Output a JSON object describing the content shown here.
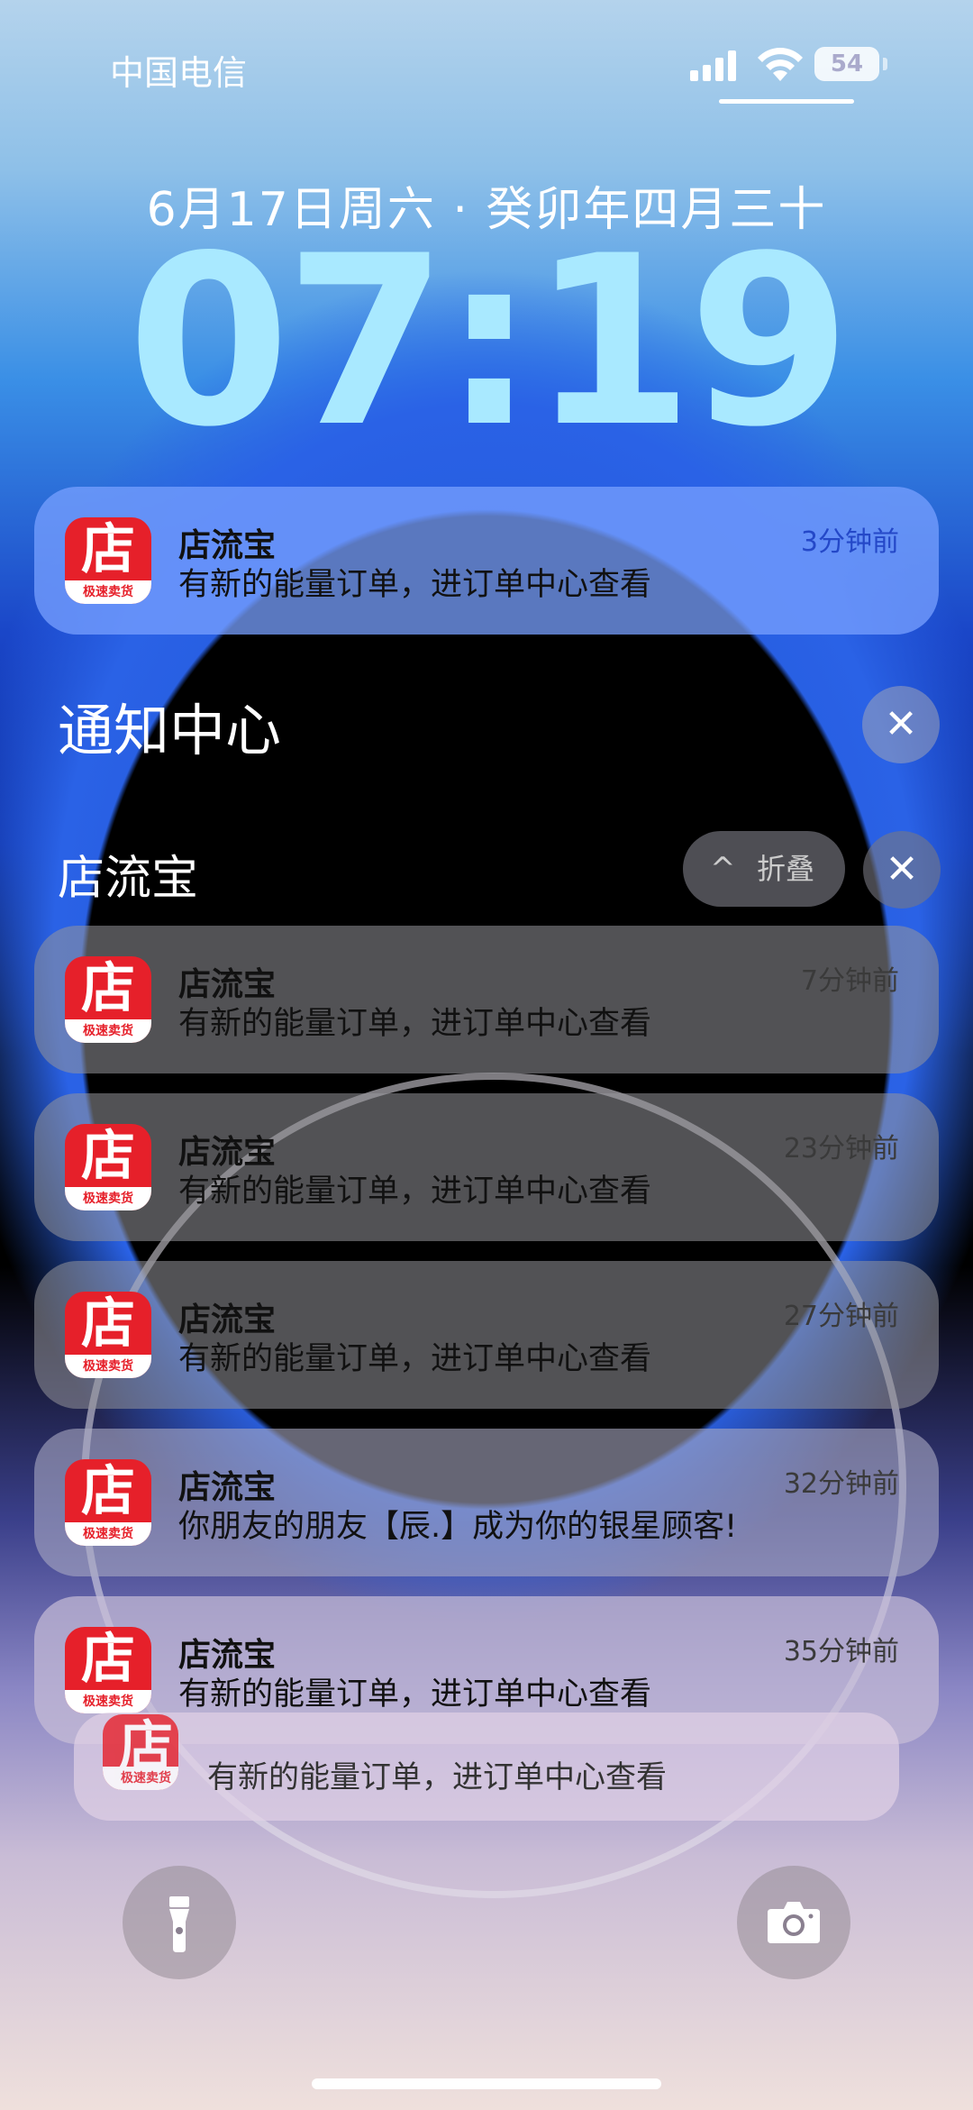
{
  "status_bar": {
    "carrier": "中国电信",
    "battery": "54"
  },
  "lock": {
    "date": "6月17日周六 · 癸卯年四月三十",
    "time": "07:19"
  },
  "app_icon": {
    "glyph": "店",
    "band": "极速卖货"
  },
  "top_notification": {
    "app": "店流宝",
    "body": "有新的能量订单，进订单中心查看",
    "time": "3分钟前"
  },
  "notification_center": {
    "title": "通知中心",
    "close": "✕"
  },
  "group": {
    "name": "店流宝",
    "collapse_label": "折叠",
    "collapse_chevron": "^",
    "close": "✕"
  },
  "notifications": [
    {
      "app": "店流宝",
      "body": "有新的能量订单，进订单中心查看",
      "time": "7分钟前"
    },
    {
      "app": "店流宝",
      "body": "有新的能量订单，进订单中心查看",
      "time": "23分钟前"
    },
    {
      "app": "店流宝",
      "body": "有新的能量订单，进订单中心查看",
      "time": "27分钟前"
    },
    {
      "app": "店流宝",
      "body": "你朋友的朋友【辰.】成为你的银星顾客!",
      "time": "32分钟前"
    },
    {
      "app": "店流宝",
      "body": "有新的能量订单，进订单中心查看",
      "time": "35分钟前"
    }
  ],
  "stacked_notification": {
    "body": "有新的能量订单，进订单中心查看"
  },
  "actions": {
    "flashlight": "flashlight-icon",
    "camera": "camera-icon"
  }
}
